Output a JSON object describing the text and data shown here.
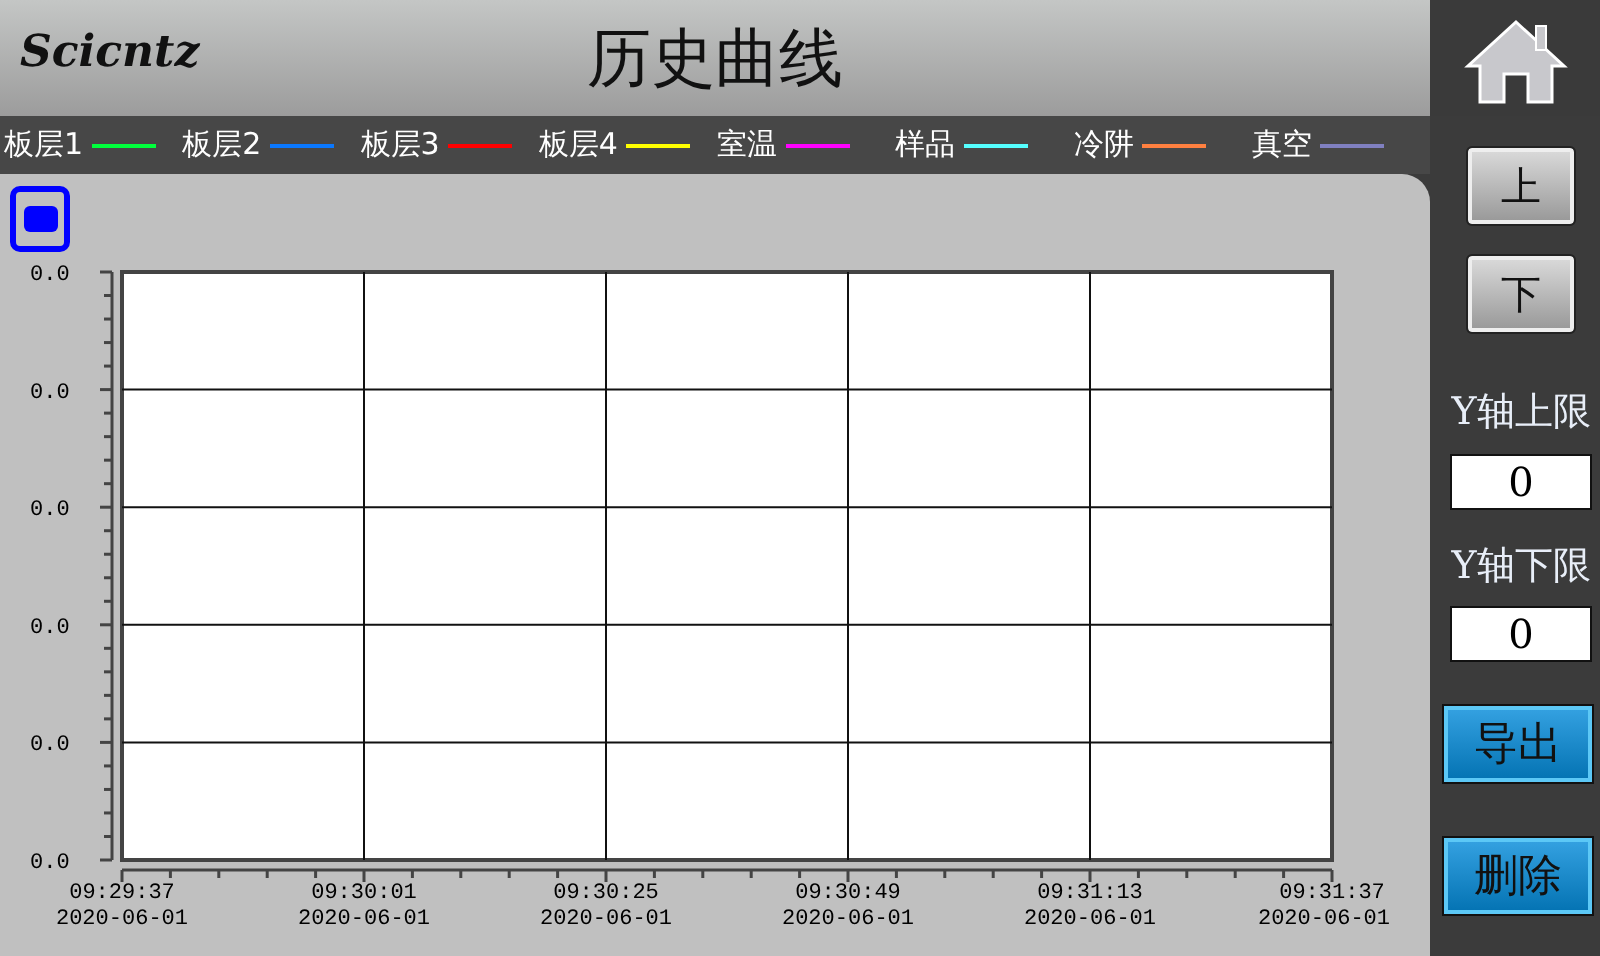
{
  "header": {
    "logo": "Scicntz",
    "title": "历史曲线"
  },
  "legend": [
    {
      "label": "板层1",
      "color": "#00ff3c"
    },
    {
      "label": "板层2",
      "color": "#0a78ff"
    },
    {
      "label": "板层3",
      "color": "#ff0000"
    },
    {
      "label": "板层4",
      "color": "#ffff00"
    },
    {
      "label": "室温",
      "color": "#ff00ff"
    },
    {
      "label": "样品",
      "color": "#55ffff"
    },
    {
      "label": "冷阱",
      "color": "#ff8040"
    },
    {
      "label": "真空",
      "color": "#8080c0"
    }
  ],
  "chart": {
    "y_labels": [
      "0.0",
      "0.0",
      "0.0",
      "0.0",
      "0.0",
      "0.0"
    ],
    "x_labels": [
      {
        "time": "09:29:37",
        "date": "2020-06-01"
      },
      {
        "time": "09:30:01",
        "date": "2020-06-01"
      },
      {
        "time": "09:30:25",
        "date": "2020-06-01"
      },
      {
        "time": "09:30:49",
        "date": "2020-06-01"
      },
      {
        "time": "09:31:13",
        "date": "2020-06-01"
      },
      {
        "time": "09:31:37",
        "date": "2020-06-01"
      }
    ]
  },
  "sidebar": {
    "up_button": "上",
    "down_button": "下",
    "y_max_label": "Y轴上限",
    "y_max_value": "0",
    "y_min_label": "Y轴下限",
    "y_min_value": "0",
    "export_button": "导出",
    "delete_button": "删除"
  }
}
